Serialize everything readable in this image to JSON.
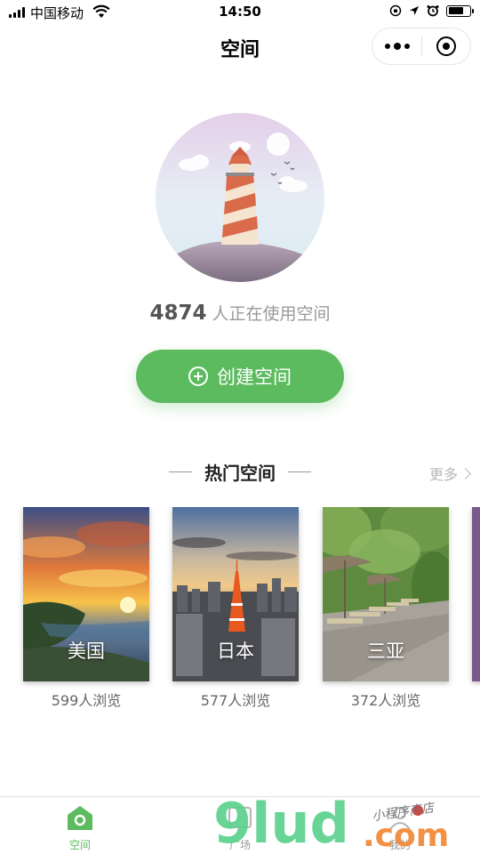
{
  "status_bar": {
    "carrier": "中国移动",
    "time": "14:50",
    "battery_percent": 85
  },
  "nav": {
    "title": "空间"
  },
  "hero": {
    "user_count": "4874",
    "user_count_suffix": "人正在使用空间",
    "create_button": "创建空间"
  },
  "hot": {
    "title": "热门空间",
    "more": "更多",
    "cards": [
      {
        "name": "美国",
        "views": "599人浏览"
      },
      {
        "name": "日本",
        "views": "577人浏览"
      },
      {
        "name": "三亚",
        "views": "372人浏览"
      }
    ]
  },
  "tabbar": {
    "items": [
      {
        "label": "空间",
        "icon": "home-icon",
        "active": true
      },
      {
        "label": "广场",
        "icon": "square-icon",
        "active": false
      },
      {
        "label": "我的",
        "icon": "user-icon",
        "active": false
      }
    ],
    "active_color": "#5cbb5f"
  },
  "watermark": {
    "brand": "9lud",
    "domain": ".com",
    "tagline": "小程序商店"
  },
  "colors": {
    "accent": "#5cbb5f"
  }
}
